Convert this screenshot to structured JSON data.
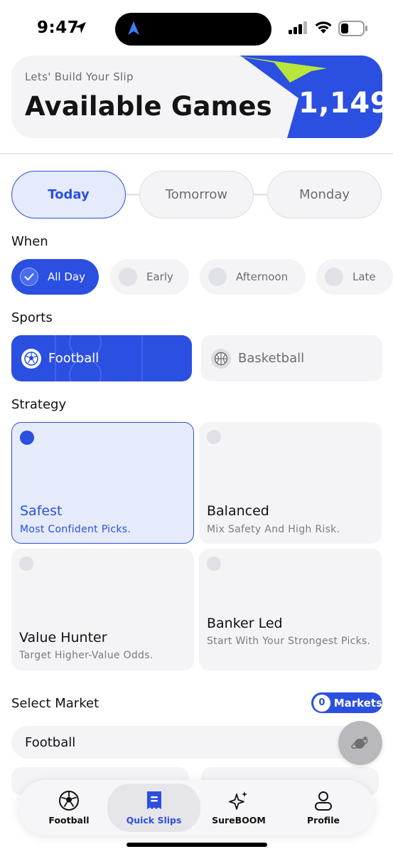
{
  "status_bar": {
    "time": "9:47"
  },
  "header": {
    "subtitle": "Lets' Build Your Slip",
    "title": "Available Games",
    "count": "1,149",
    "accent_blue": "#2b4fe0",
    "accent_lime": "#b8e63a"
  },
  "days": [
    {
      "label": "Today",
      "active": true
    },
    {
      "label": "Tomorrow",
      "active": false
    },
    {
      "label": "Monday",
      "active": false
    }
  ],
  "when": {
    "label": "When",
    "options": [
      {
        "label": "All Day",
        "selected": true
      },
      {
        "label": "Early",
        "selected": false
      },
      {
        "label": "Afternoon",
        "selected": false
      },
      {
        "label": "Late",
        "selected": false
      }
    ]
  },
  "sports": {
    "label": "Sports",
    "options": [
      {
        "label": "Football",
        "icon": "soccer-ball-icon",
        "selected": true
      },
      {
        "label": "Basketball",
        "icon": "basketball-icon",
        "selected": false
      }
    ]
  },
  "strategy": {
    "label": "Strategy",
    "options": [
      {
        "name": "Safest",
        "desc": "Most Confident Picks.",
        "selected": true
      },
      {
        "name": "Balanced",
        "desc": "Mix Safety And High Risk.",
        "selected": false
      },
      {
        "name": "Value Hunter",
        "desc": "Target Higher-Value Odds.",
        "selected": false
      },
      {
        "name": "Banker Led",
        "desc": "Start With Your Strongest Picks.",
        "selected": false
      }
    ]
  },
  "market": {
    "label": "Select Market",
    "count": "0",
    "count_label": "Markets",
    "current": "Football"
  },
  "nav": {
    "items": [
      {
        "label": "Football",
        "icon": "soccer-ball-icon",
        "active": false
      },
      {
        "label": "Quick Slips",
        "icon": "receipt-icon",
        "active": true
      },
      {
        "label": "SureBOOM",
        "icon": "sparkles-icon",
        "active": false
      },
      {
        "label": "Profile",
        "icon": "person-icon",
        "active": false
      }
    ]
  }
}
